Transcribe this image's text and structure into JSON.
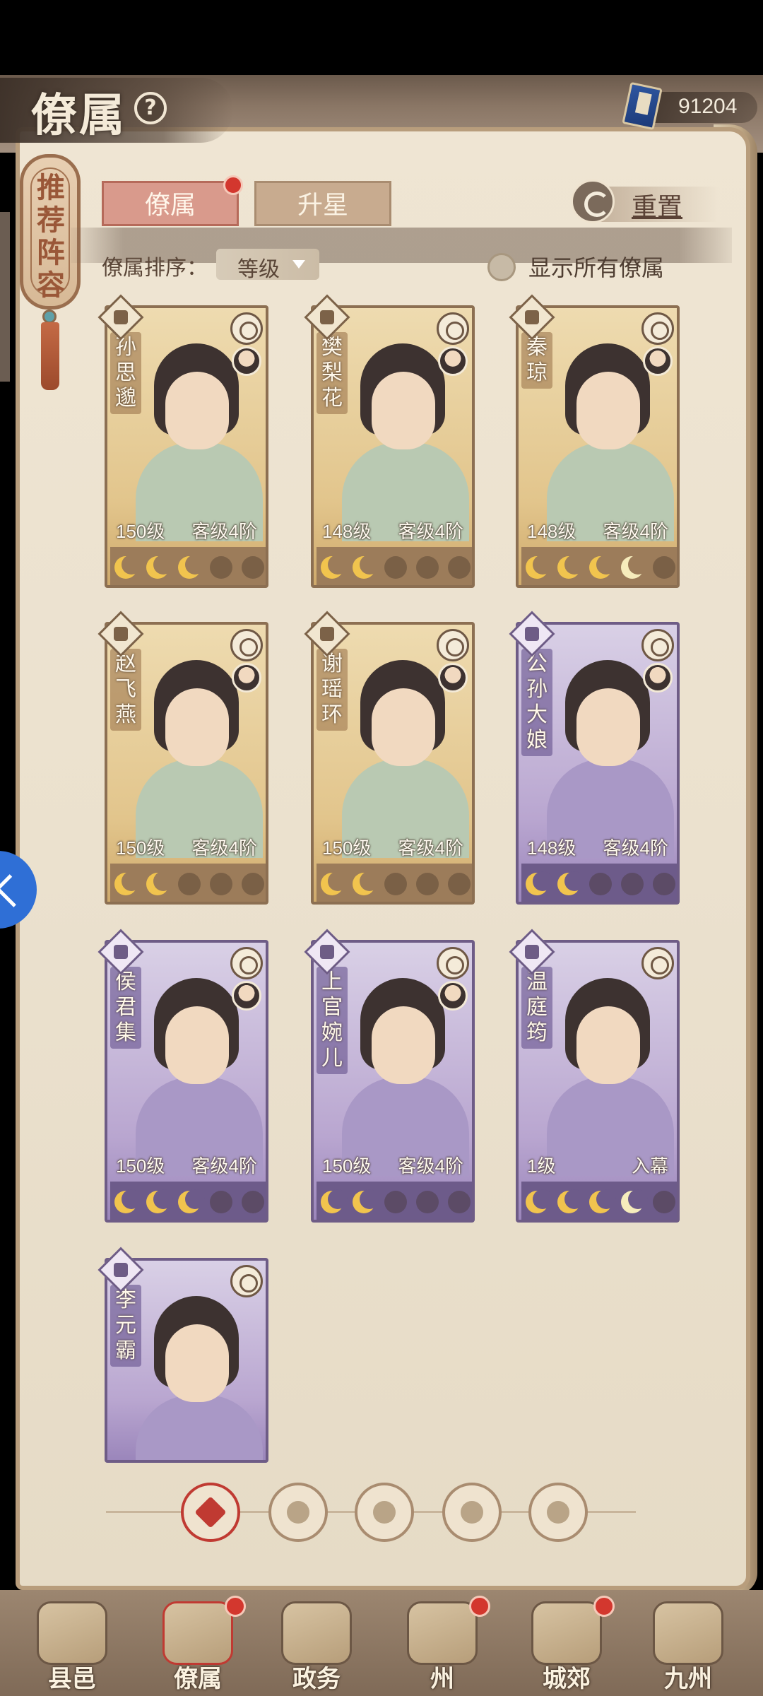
{
  "header": {
    "title": "僚属",
    "currency_value": "91204"
  },
  "side_banner": {
    "label": "推荐阵容"
  },
  "tabs": [
    {
      "label": "僚属",
      "active": true
    },
    {
      "label": "升星",
      "active": false
    }
  ],
  "reset_label": "重置",
  "sort": {
    "label": "僚属排序：",
    "value": "等级"
  },
  "show_all_label": "显示所有僚属",
  "cards": [
    {
      "name": "孙思邈",
      "level": "150级",
      "rank": "客级4阶",
      "stars": [
        1,
        1,
        1,
        0,
        0
      ],
      "color": "gold"
    },
    {
      "name": "樊梨花",
      "level": "148级",
      "rank": "客级4阶",
      "stars": [
        1,
        1,
        0,
        0,
        0
      ],
      "color": "gold"
    },
    {
      "name": "秦琼",
      "level": "148级",
      "rank": "客级4阶",
      "stars": [
        1,
        1,
        1,
        0.5,
        0
      ],
      "color": "gold"
    },
    {
      "name": "赵飞燕",
      "level": "150级",
      "rank": "客级4阶",
      "stars": [
        1,
        1,
        0,
        0,
        0
      ],
      "color": "gold"
    },
    {
      "name": "谢瑶环",
      "level": "150级",
      "rank": "客级4阶",
      "stars": [
        1,
        1,
        0,
        0,
        0
      ],
      "color": "gold"
    },
    {
      "name": "公孙大娘",
      "level": "148级",
      "rank": "客级4阶",
      "stars": [
        1,
        1,
        0,
        0,
        0
      ],
      "color": "purple"
    },
    {
      "name": "侯君集",
      "level": "150级",
      "rank": "客级4阶",
      "stars": [
        1,
        1,
        1,
        0,
        0
      ],
      "color": "purple"
    },
    {
      "name": "上官婉儿",
      "level": "150级",
      "rank": "客级4阶",
      "stars": [
        1,
        1,
        0,
        0,
        0
      ],
      "color": "purple"
    },
    {
      "name": "温庭筠",
      "level": "1级",
      "rank": "入幕",
      "stars": [
        1,
        1,
        1,
        0.5,
        0
      ],
      "color": "purple"
    },
    {
      "name": "李元霸",
      "level": "",
      "rank": "",
      "stars": [],
      "color": "purple"
    }
  ],
  "filters": [
    {
      "icon": "all-filter-icon",
      "active": true
    },
    {
      "icon": "bell-filter-icon",
      "active": false
    },
    {
      "icon": "cat-filter-icon",
      "active": false
    },
    {
      "icon": "fan-filter-icon",
      "active": false
    },
    {
      "icon": "beast-filter-icon",
      "active": false
    }
  ],
  "bottom_nav": [
    {
      "label": "县邑",
      "dot": false,
      "active": false
    },
    {
      "label": "僚属",
      "dot": true,
      "active": true
    },
    {
      "label": "政务",
      "dot": false,
      "active": false
    },
    {
      "label": "州",
      "dot": true,
      "active": false
    },
    {
      "label": "城郊",
      "dot": true,
      "active": false
    },
    {
      "label": "九州",
      "dot": false,
      "active": false
    }
  ]
}
